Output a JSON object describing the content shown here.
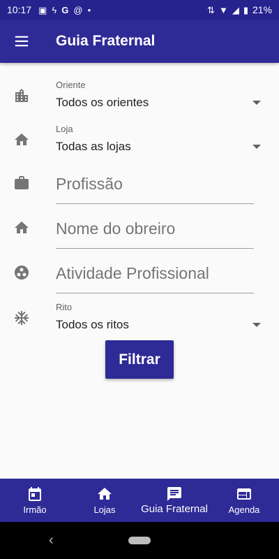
{
  "status_bar": {
    "time": "10:17",
    "battery": "21%",
    "icons": [
      "image-icon",
      "bolt-icon",
      "google-icon",
      "at-icon",
      "dot-icon"
    ]
  },
  "app_bar": {
    "title": "Guia Fraternal"
  },
  "form": {
    "oriente": {
      "label": "Oriente",
      "value": "Todos os orientes",
      "icon": "city-icon"
    },
    "loja": {
      "label": "Loja",
      "value": "Todas as lojas",
      "icon": "home-icon"
    },
    "profissao": {
      "placeholder": "Profissão",
      "icon": "briefcase-icon"
    },
    "obreiro": {
      "placeholder": "Nome do obreiro",
      "icon": "home-icon"
    },
    "atividade": {
      "placeholder": "Atividade Profissional",
      "icon": "palette-icon"
    },
    "rito": {
      "label": "Rito",
      "value": "Todos os ritos",
      "icon": "snowflake-icon"
    },
    "filter_button": "Filtrar"
  },
  "bottom_nav": {
    "items": [
      {
        "label": "Irmão",
        "icon": "calendar-icon",
        "active": false
      },
      {
        "label": "Lojas",
        "icon": "home-icon",
        "active": false
      },
      {
        "label": "Guia Fraternal",
        "icon": "message-icon",
        "active": true
      },
      {
        "label": "Agenda",
        "icon": "web-icon",
        "active": false
      }
    ]
  },
  "colors": {
    "primary": "#2e2a96",
    "status_bar": "#26238f",
    "background": "#fafafa"
  }
}
